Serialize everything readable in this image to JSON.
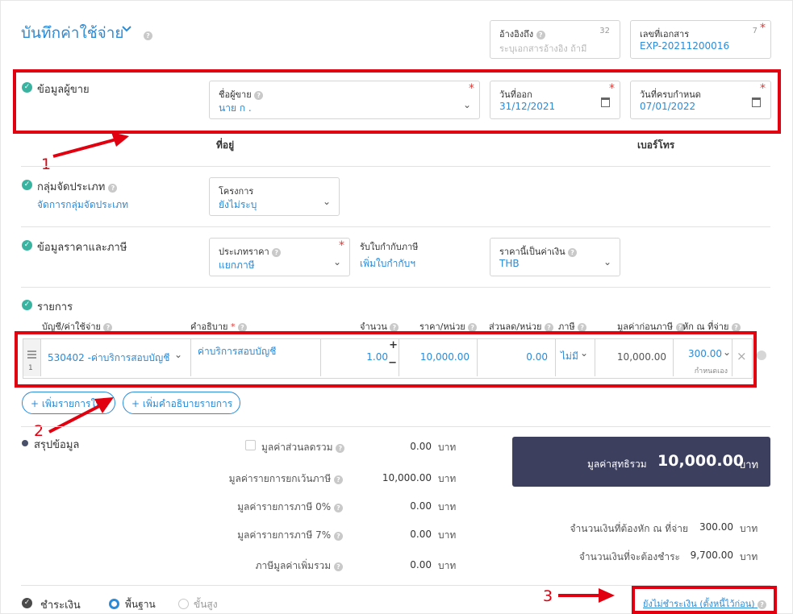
{
  "header": {
    "title": "บันทึกค่าใช้จ่าย",
    "reference": {
      "label": "อ้างอิงถึง",
      "placeholder": "ระบุเอกสารอ้างอิง ถ้ามี",
      "counter": "32"
    },
    "doc_number": {
      "label": "เลขที่เอกสาร",
      "value": "EXP-20211200016",
      "counter": "7"
    }
  },
  "vendor": {
    "section_title": "ข้อมูลผู้ขาย",
    "name": {
      "label": "ชื่อผู้ขาย",
      "value": "นาย ก ."
    },
    "issue_date": {
      "label": "วันที่ออก",
      "value": "31/12/2021"
    },
    "due_date": {
      "label": "วันที่ครบกำหนด",
      "value": "07/01/2022"
    },
    "address_label": "ที่อยู่",
    "phone_label": "เบอร์โทร"
  },
  "category": {
    "section_title": "กลุ่มจัดประเภท",
    "manage_link": "จัดการกลุ่มจัดประเภท",
    "project": {
      "label": "โครงการ",
      "value": "ยังไม่ระบุ"
    }
  },
  "pricing": {
    "section_title": "ข้อมูลราคาและภาษี",
    "price_type": {
      "label": "ประเภทราคา",
      "value": "แยกภาษี"
    },
    "tax_invoice": {
      "label": "รับใบกำกับภาษี",
      "link": "เพิ่มใบกำกับฯ"
    },
    "currency": {
      "label": "ราคานี้เป็นค่าเงิน",
      "value": "THB"
    }
  },
  "items": {
    "section_title": "รายการ",
    "columns": {
      "account": "บัญชี/ค่าใช้จ่าย",
      "description": "คำอธิบาย",
      "quantity": "จำนวน",
      "unit_price": "ราคา/หน่วย",
      "discount": "ส่วนลด/หน่วย",
      "tax": "ภาษี",
      "pre_tax": "มูลค่าก่อนภาษี",
      "withholding": "หัก ณ ที่จ่าย"
    },
    "rows": [
      {
        "index": "1",
        "account": "530402 -ค่าบริการสอบบัญชี",
        "description": "ค่าบริการสอบบัญชี",
        "quantity": "1.00",
        "unit_price": "10,000.00",
        "discount": "0.00",
        "tax": "ไม่มี",
        "pre_tax": "10,000.00",
        "withholding": "300.00",
        "withholding_note": "กำหนดเอง"
      }
    ],
    "add_item_button": "เพิ่มรายการใหม่",
    "add_description_button": "เพิ่มคำอธิบายรายการ"
  },
  "summary": {
    "section_title": "สรุปข้อมูล",
    "discount_total": {
      "label": "มูลค่าส่วนลดรวม",
      "value": "0.00"
    },
    "exempt_total": {
      "label": "มูลค่ารายการยกเว้นภาษี",
      "value": "10,000.00"
    },
    "zero_rate_total": {
      "label": "มูลค่ารายการภาษี 0%",
      "value": "0.00"
    },
    "vat7_total": {
      "label": "มูลค่ารายการภาษี 7%",
      "value": "0.00"
    },
    "vat_total": {
      "label": "ภาษีมูลค่าเพิ่มรวม",
      "value": "0.00"
    },
    "currency_unit": "บาท",
    "net_total": {
      "label": "มูลค่าสุทธิรวม",
      "value": "10,000.00"
    },
    "withholding_amount": {
      "label": "จำนวนเงินที่ต้องหัก ณ ที่จ่าย",
      "value": "300.00"
    },
    "payable_amount": {
      "label": "จำนวนเงินที่จะต้องชำระ",
      "value": "9,700.00"
    }
  },
  "payment": {
    "section_title": "ชำระเงิน",
    "mode_basic": "พื้นฐาน",
    "mode_advanced": "ขั้นสูง",
    "status_link": "ยังไม่ชำระเงิน (ตั้งหนี้ไว้ก่อน)"
  },
  "annotations": [
    "1",
    "2",
    "3"
  ],
  "colors": {
    "accent": "#2a8bd8",
    "check": "#3bb3a1",
    "highlight": "#e0000f",
    "net_box": "#3d3f5f"
  }
}
